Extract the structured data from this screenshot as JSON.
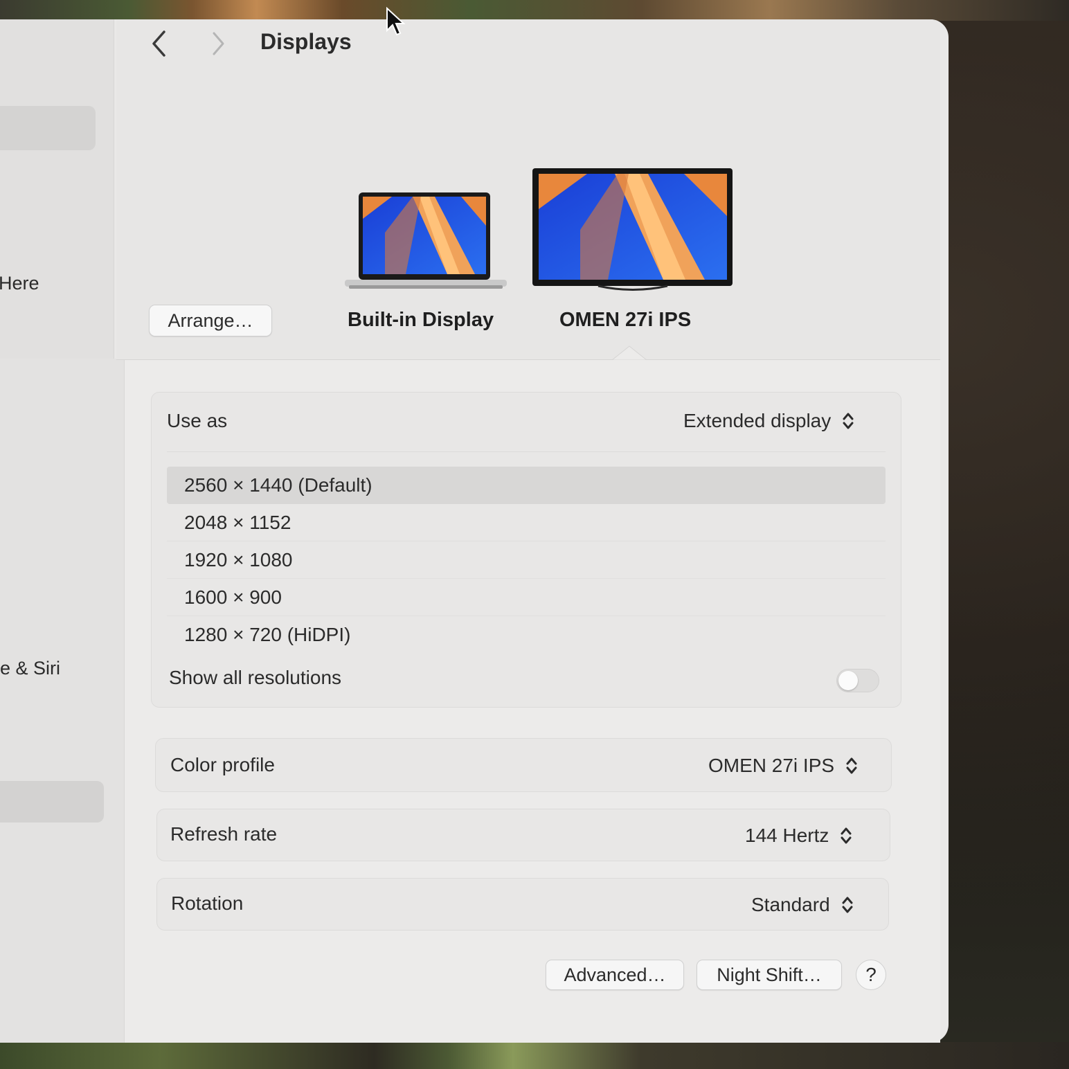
{
  "window": {
    "title": "Displays"
  },
  "sidebar": {
    "items": [
      {
        "label": "Here"
      },
      {
        "label": "e & Siri"
      }
    ]
  },
  "toolbar": {
    "back_icon": "chevron-left-icon",
    "forward_icon": "chevron-right-icon"
  },
  "displays": {
    "arrange_label": "Arrange…",
    "items": [
      {
        "name": "Built-in Display",
        "icon": "laptop-icon",
        "selected": false
      },
      {
        "name": "OMEN 27i IPS",
        "icon": "monitor-icon",
        "selected": true
      }
    ]
  },
  "use_as": {
    "label": "Use as",
    "value": "Extended display"
  },
  "resolutions": {
    "options": [
      {
        "label": "2560 × 1440 (Default)",
        "selected": true
      },
      {
        "label": "2048 × 1152",
        "selected": false
      },
      {
        "label": "1920 × 1080",
        "selected": false
      },
      {
        "label": "1600 × 900",
        "selected": false
      },
      {
        "label": "1280 × 720 (HiDPI)",
        "selected": false
      }
    ],
    "show_all_label": "Show all resolutions",
    "show_all_enabled": false
  },
  "color_profile": {
    "label": "Color profile",
    "value": "OMEN 27i IPS"
  },
  "refresh_rate": {
    "label": "Refresh rate",
    "value": "144 Hertz"
  },
  "rotation": {
    "label": "Rotation",
    "value": "Standard"
  },
  "footer": {
    "advanced_label": "Advanced…",
    "night_shift_label": "Night Shift…",
    "help_label": "?"
  },
  "colors": {
    "window_bg": "#e9e8e7",
    "selected_row": "#d8d7d6",
    "text": "#2b2b2b"
  }
}
